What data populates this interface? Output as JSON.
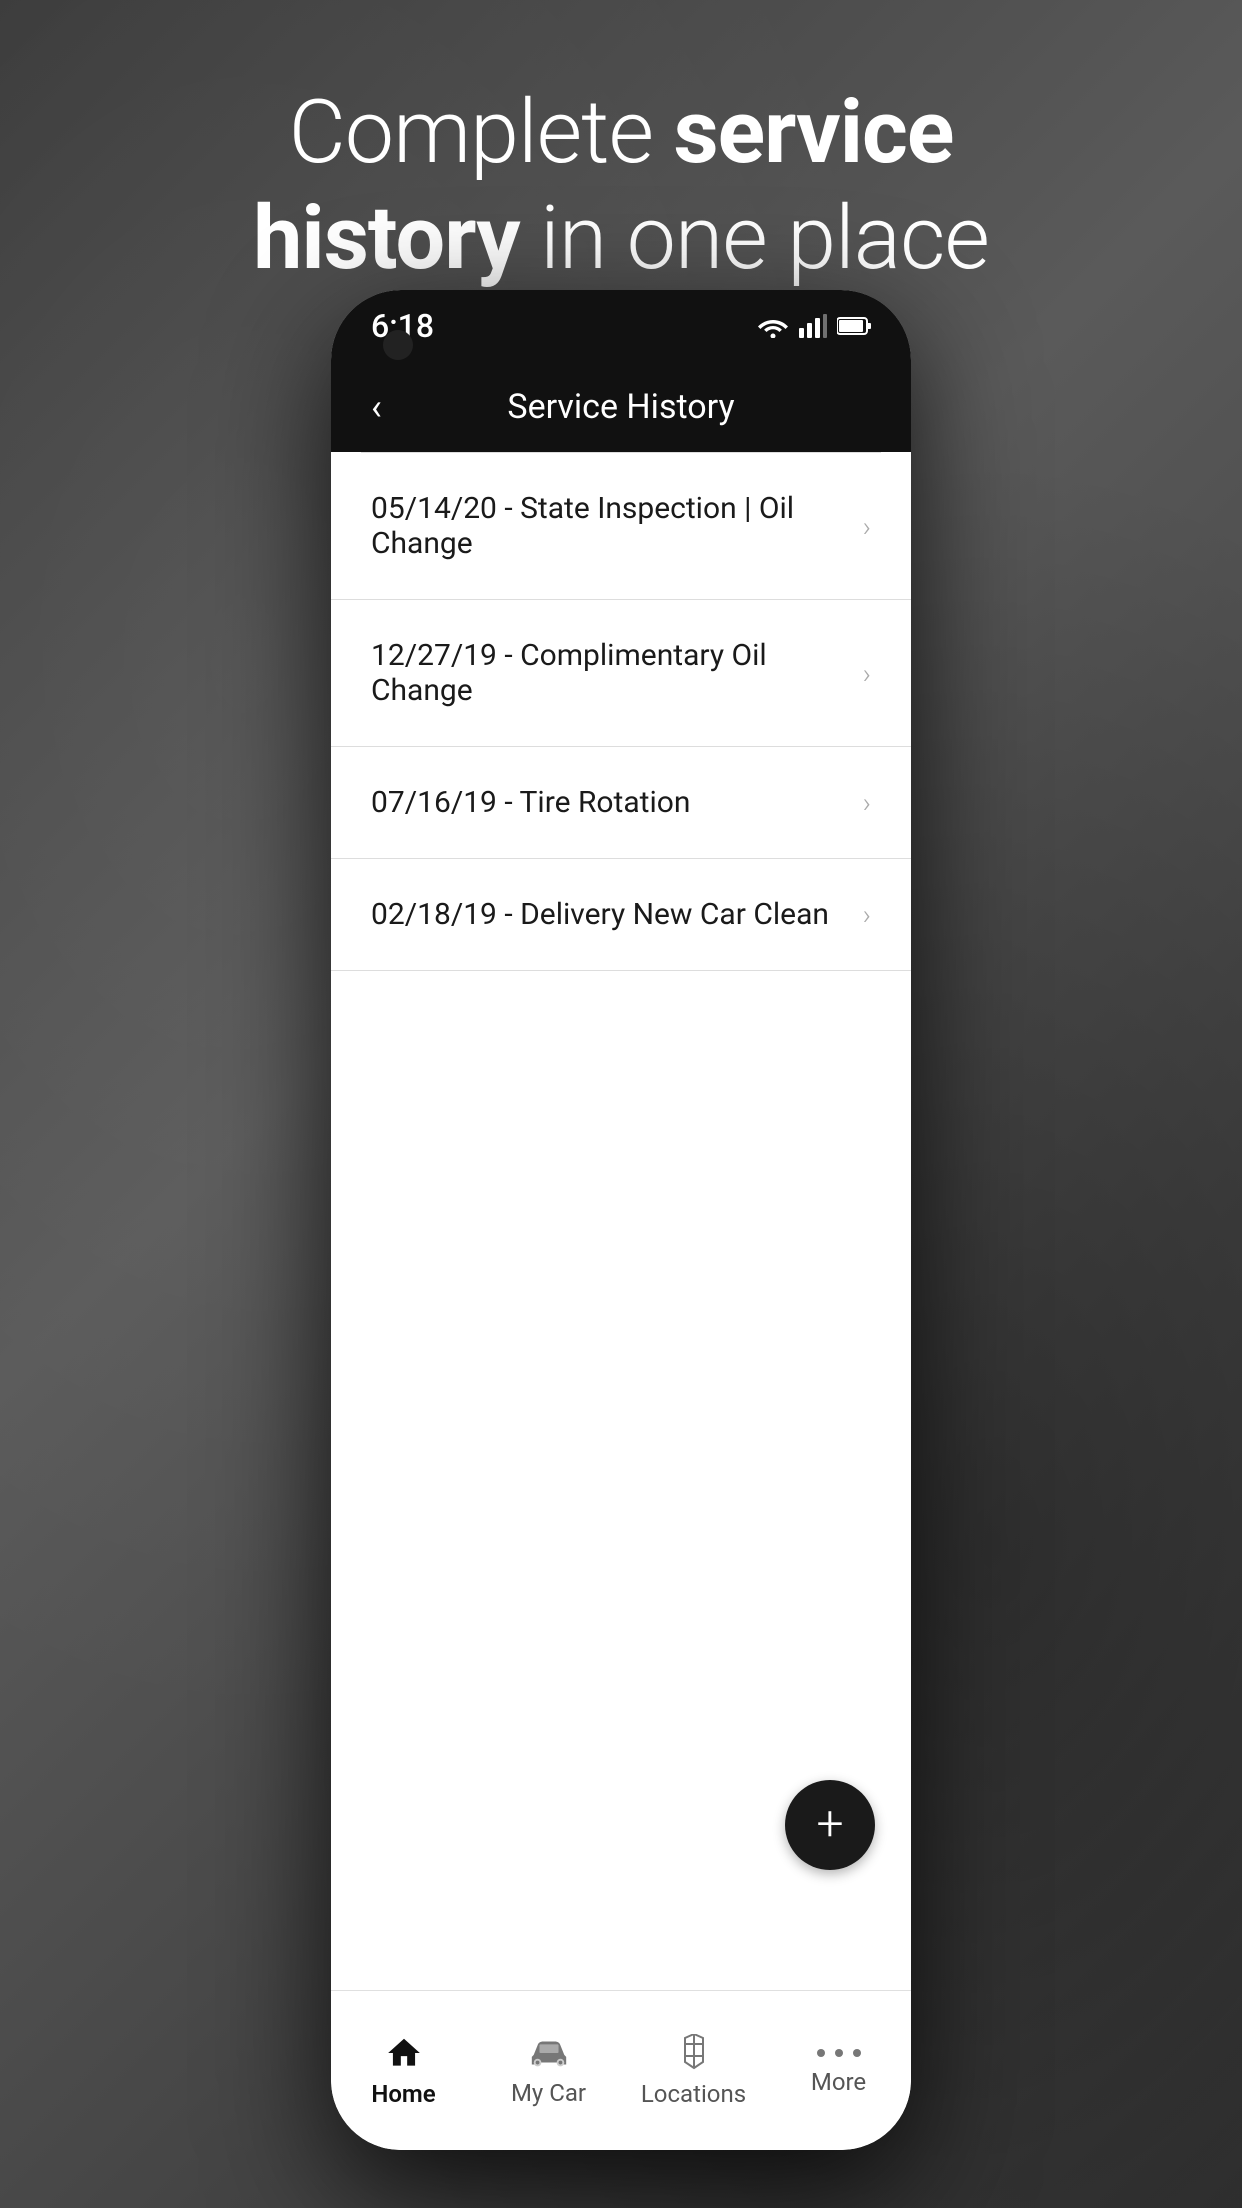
{
  "background": {
    "headline_part1": "Complete ",
    "headline_bold1": "service",
    "headline_part2": " ",
    "headline_bold2": "history",
    "headline_part3": " in one place"
  },
  "status_bar": {
    "time": "6:18",
    "wifi_icon": "wifi",
    "signal_icon": "signal",
    "battery_icon": "battery"
  },
  "app_header": {
    "title": "Service History",
    "back_label": "‹"
  },
  "service_items": [
    {
      "id": 1,
      "label": "05/14/20 - State Inspection | Oil Change"
    },
    {
      "id": 2,
      "label": "12/27/19 - Complimentary Oil Change"
    },
    {
      "id": 3,
      "label": "07/16/19 - Tire Rotation"
    },
    {
      "id": 4,
      "label": "02/18/19 - Delivery New Car Clean"
    }
  ],
  "fab": {
    "label": "+"
  },
  "bottom_nav": {
    "items": [
      {
        "id": "home",
        "label": "Home",
        "active": true
      },
      {
        "id": "mycar",
        "label": "My Car",
        "active": false
      },
      {
        "id": "locations",
        "label": "Locations",
        "active": false
      },
      {
        "id": "more",
        "label": "More",
        "active": false
      }
    ]
  }
}
